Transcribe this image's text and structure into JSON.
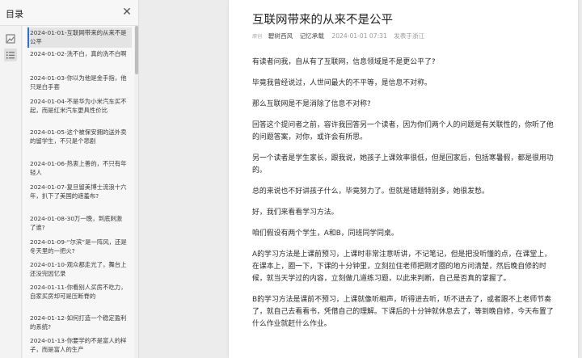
{
  "sidebar": {
    "title": "目录",
    "close_icon": "close-icon",
    "rail_icons": [
      "image-icon",
      "list-icon"
    ],
    "items": [
      {
        "date": "2024-01-01-",
        "title": "互联网带来的从来不是公平"
      },
      {
        "date": "2024-01-02-",
        "title": "洗不白，真的洗不白啊"
      },
      {
        "date": "2024-01-03-",
        "title": "你以为他是金手指，他只是白手套"
      },
      {
        "date": "2024-01-04-",
        "title": "不是华为小米汽车买不起，而是红米汽车更具性价比"
      },
      {
        "date": "2024-01-05-",
        "title": "这个被保安拥的送外卖的留学生，不只是个悲剧"
      },
      {
        "date": "2024-01-06-",
        "title": "热衷上善的，不只有年轻人"
      },
      {
        "date": "2024-01-07-",
        "title": "复旦留美博士流浪十六年，扒下了美国的遮羞布?"
      },
      {
        "date": "2024-01-08-",
        "title": "30万一晚，到底刺激了谁?"
      },
      {
        "date": "2024-01-09-",
        "title": "“尔滨”是一阵风，还是冬天里的一把火?"
      },
      {
        "date": "2024-01-10-",
        "title": "观众都走光了，舞台上还没完因忆录"
      },
      {
        "date": "2024-01-11-",
        "title": "你看别人买房不吃力，自家买房却可是压断脊的"
      },
      {
        "date": "2024-01-12-",
        "title": "如何打造一个稳定盈利的系统?"
      },
      {
        "date": "2024-01-13-",
        "title": "你要学的不是富人的样子，而是富人的生产"
      }
    ]
  },
  "article": {
    "title": "互联网带来的从来不是公平",
    "meta": {
      "tag": "原创",
      "author": "碧树西风",
      "account": "记忆承载",
      "datetime": "2024-01-01 07:31",
      "location": "发表于浙江"
    },
    "paragraphs": [
      "有读者问我，自从有了互联网，信息领域是不是更公平了?",
      "毕竟我曾经说过，人世间最大的不平等，是信息不对称。",
      "那么互联网是不是消除了信息不对称?",
      "回答这个提问者之前，容许我回答另一个读者，因为你们两个人的问题是有关联性的，你听了他的问题答案，对你，或许会有所思。",
      "另一个读者是学生家长，跟我说，她孩子上课效率很低，但是回家后，包括寒暑假，都是很用功的。",
      "总的来说也不好讲孩子什么，毕竟努力了。但就是错题特别多，她很发愁。",
      "好，我们来看看学习方法。",
      "咱们假设有两个学生，A和B，同班同学同桌。",
      "A的学习方法是上课前预习，上课时非常注意听讲，不记笔记，但是把没听懂的点，在课堂上，在课本上，圈一下，下课的十分钟里，立刻拉住老师把刚才圈的地方问清楚，然后晚自修的时候，就当天学过的内容，立刻做几道练习题，以此来判断，自己是否真的掌握了。",
      "B的学习方法是课前不预习，上课就像听相声，听得进去听，听不进去了，或者跟不上老师节奏了，就自己去看看书，凭借自己的理解。下课后的十分钟就休息去了，等到晚自修，今天布置了什么作业就赶什么作业。"
    ]
  }
}
